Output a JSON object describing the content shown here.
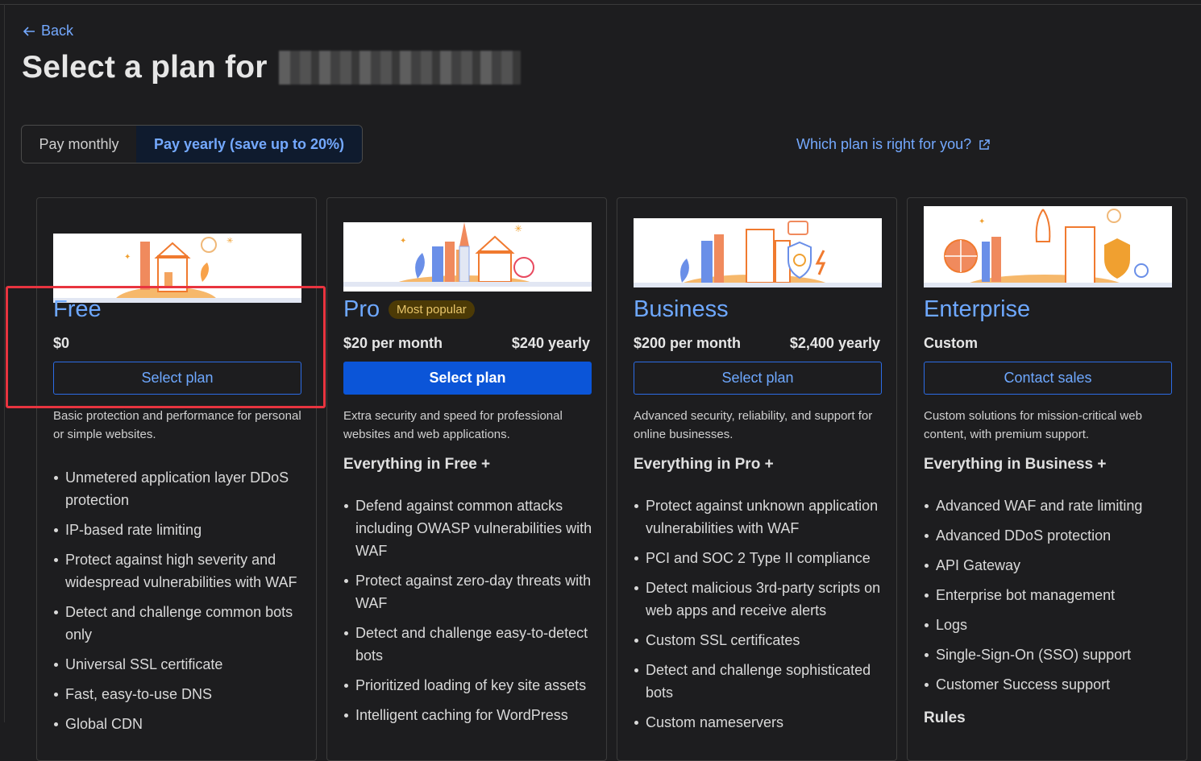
{
  "nav": {
    "back_label": "Back"
  },
  "page": {
    "title": "Select a plan for"
  },
  "billing_toggle": {
    "monthly_label": "Pay monthly",
    "yearly_label": "Pay yearly (save up to 20%)"
  },
  "help_link": {
    "label": "Which plan is right for you?"
  },
  "colors": {
    "accent": "#6ea8ff",
    "primary_button": "#0b55d8",
    "highlight": "#e8343f",
    "background": "#1d1d1f"
  },
  "plans": [
    {
      "name": "Free",
      "price": "$0",
      "button_label": "Select plan",
      "description": "Basic protection and performance for personal or simple websites.",
      "features": [
        "Unmetered application layer DDoS protection",
        "IP-based rate limiting",
        "Protect against high severity and widespread vulnerabilities with WAF",
        "Detect and challenge common bots only",
        "Universal SSL certificate",
        "Fast, easy-to-use DNS",
        "Global CDN"
      ]
    },
    {
      "name": "Pro",
      "badge": "Most popular",
      "price": "$20 per month",
      "price_yearly": "$240 yearly",
      "button_label": "Select plan",
      "description": "Extra security and speed for professional websites and web applications.",
      "everything_label": "Everything in Free +",
      "features": [
        "Defend against common attacks including OWASP vulnerabilities with WAF",
        "Protect against zero-day threats with WAF",
        "Detect and challenge easy-to-detect bots",
        "Prioritized loading of key site assets",
        "Intelligent caching for WordPress"
      ]
    },
    {
      "name": "Business",
      "price": "$200 per month",
      "price_yearly": "$2,400 yearly",
      "button_label": "Select plan",
      "description": "Advanced security, reliability, and support for online businesses.",
      "everything_label": "Everything in Pro +",
      "features": [
        "Protect against unknown application vulnerabilities with WAF",
        "PCI and SOC 2 Type II compliance",
        "Detect malicious 3rd-party scripts on web apps and receive alerts",
        "Custom SSL certificates",
        "Detect and challenge sophisticated bots",
        "Custom nameservers"
      ]
    },
    {
      "name": "Enterprise",
      "price": "Custom",
      "button_label": "Contact sales",
      "description": "Custom solutions for mission-critical web content, with premium support.",
      "everything_label": "Everything in Business +",
      "features": [
        "Advanced WAF and rate limiting",
        "Advanced DDoS protection",
        "API Gateway",
        "Enterprise bot management",
        "Logs",
        "Single-Sign-On (SSO) support",
        "Customer Success support"
      ],
      "rules_label": "Rules"
    }
  ]
}
